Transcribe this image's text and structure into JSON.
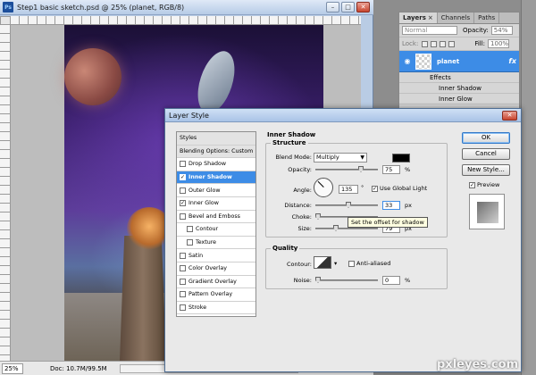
{
  "document": {
    "title": "Step1 basic sketch.psd @ 25% (planet, RGB/8)",
    "app_icon_text": "Ps",
    "window_buttons": {
      "minimize": "–",
      "maximize": "□",
      "close": "✕"
    }
  },
  "status_bar": {
    "zoom": "25%",
    "doc_size": "Doc: 10.7M/99.5M"
  },
  "layers_panel": {
    "tabs": [
      {
        "label": "Layers",
        "close": "×"
      },
      {
        "label": "Channels"
      },
      {
        "label": "Paths"
      }
    ],
    "blend_mode": "Normal",
    "opacity_label": "Opacity:",
    "opacity_value": "54%",
    "lock_label": "Lock:",
    "fill_label": "Fill:",
    "fill_value": "100%",
    "layer": {
      "name": "planet",
      "fx": "fx"
    },
    "effects_label": "Effects",
    "effects": [
      "Inner Shadow",
      "Inner Glow"
    ]
  },
  "dialog": {
    "title": "Layer Style",
    "close_label": "✕",
    "styles": [
      {
        "label": "Styles",
        "type": "header"
      },
      {
        "label": "Blending Options: Custom",
        "type": "header"
      },
      {
        "label": "Drop Shadow",
        "checked": false
      },
      {
        "label": "Inner Shadow",
        "checked": true,
        "selected": true
      },
      {
        "label": "Outer Glow",
        "checked": false
      },
      {
        "label": "Inner Glow",
        "checked": true
      },
      {
        "label": "Bevel and Emboss",
        "checked": false
      },
      {
        "label": "Contour",
        "checked": false,
        "indent": true
      },
      {
        "label": "Texture",
        "checked": false,
        "indent": true
      },
      {
        "label": "Satin",
        "checked": false
      },
      {
        "label": "Color Overlay",
        "checked": false
      },
      {
        "label": "Gradient Overlay",
        "checked": false
      },
      {
        "label": "Pattern Overlay",
        "checked": false
      },
      {
        "label": "Stroke",
        "checked": false
      }
    ],
    "inner_shadow": {
      "title": "Inner Shadow",
      "structure_label": "Structure",
      "blend_mode_label": "Blend Mode:",
      "blend_mode_value": "Multiply",
      "shadow_color": "#000000",
      "opacity_label": "Opacity:",
      "opacity_value": "75",
      "opacity_unit": "%",
      "opacity_fraction": 0.75,
      "angle_label": "Angle:",
      "angle_value": "135",
      "angle_unit": "°",
      "use_global_light_label": "Use Global Light",
      "use_global_light": true,
      "distance_label": "Distance:",
      "distance_value": "33",
      "distance_unit": "px",
      "choke_label": "Choke:",
      "size_label": "Size:",
      "size_value": "79",
      "size_unit": "px",
      "tooltip": "Set the offset for shadow",
      "quality_label": "Quality",
      "contour_label": "Contour:",
      "anti_aliased_label": "Anti-aliased",
      "anti_aliased": false,
      "noise_label": "Noise:",
      "noise_value": "0",
      "noise_unit": "%"
    },
    "buttons": {
      "ok": "OK",
      "cancel": "Cancel",
      "new_style": "New Style...",
      "preview_label": "Preview",
      "preview_checked": true
    }
  },
  "watermark": "pxleyes.com",
  "colors": {
    "selection_blue": "#3d8ce6",
    "dialog_bg": "#e9e9e9"
  }
}
